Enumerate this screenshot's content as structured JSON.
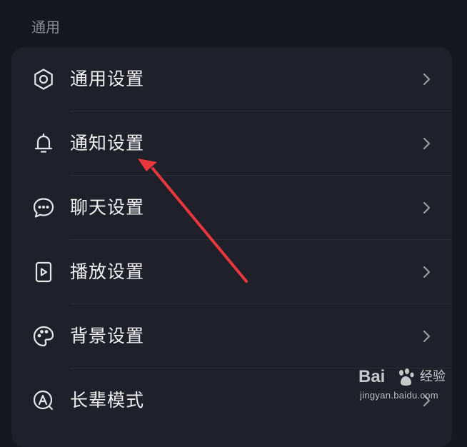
{
  "section": {
    "title": "通用"
  },
  "settings": {
    "items": [
      {
        "label": "通用设置",
        "icon": "gear-icon"
      },
      {
        "label": "通知设置",
        "icon": "bell-icon"
      },
      {
        "label": "聊天设置",
        "icon": "chat-bubble-icon"
      },
      {
        "label": "播放设置",
        "icon": "play-file-icon"
      },
      {
        "label": "背景设置",
        "icon": "palette-icon"
      },
      {
        "label": "长辈模式",
        "icon": "elder-mode-icon"
      }
    ]
  },
  "annotation": {
    "color": "#e8383d"
  },
  "watermark": {
    "brand": "Bai",
    "product": "经验",
    "url": "jingyan.baidu.com"
  }
}
